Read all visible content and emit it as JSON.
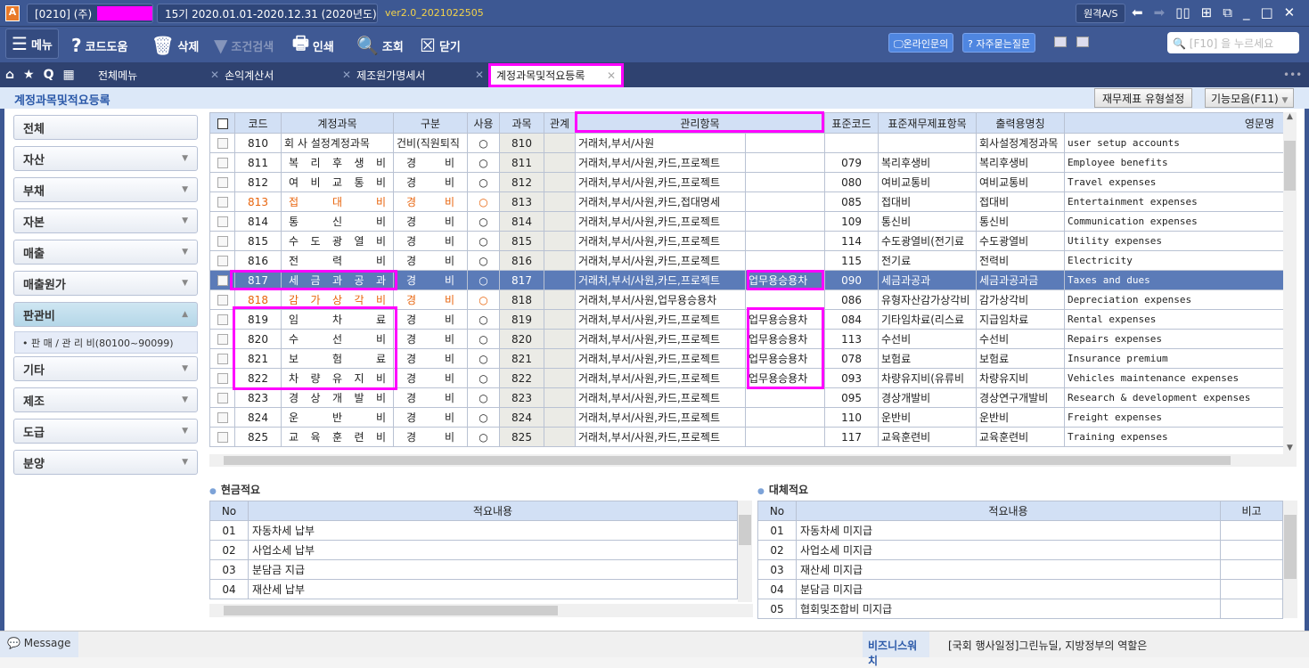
{
  "titlebar": {
    "company": "[0210] (주)",
    "period": "15기  2020.01.01-2020.12.31  (2020년도)",
    "version": "ver2.0_2021022505",
    "remote_as": "원격A/S"
  },
  "toolbar": {
    "menu": "메뉴",
    "code_help": "코드도움",
    "delete": "삭제",
    "filter": "조건검색",
    "print": "인쇄",
    "search": "조회",
    "close": "닫기",
    "online_inquiry": "온라인문의",
    "faq": "자주묻는질문",
    "search_placeholder": "[F10] 을 누르세요"
  },
  "tabs": [
    {
      "label": "전체메뉴"
    },
    {
      "label": "손익계산서"
    },
    {
      "label": "제조원가명세서"
    },
    {
      "label": "계정과목및적요등록"
    }
  ],
  "page": {
    "title": "계정과목및적요등록",
    "fs_type_btn": "재무제표 유형설정",
    "func_btn": "기능모음(F11)"
  },
  "sidebar": {
    "items": [
      {
        "label": "전체"
      },
      {
        "label": "자산"
      },
      {
        "label": "부채"
      },
      {
        "label": "자본"
      },
      {
        "label": "매출"
      },
      {
        "label": "매출원가"
      },
      {
        "label": "판관비"
      },
      {
        "label": "기타"
      },
      {
        "label": "제조"
      },
      {
        "label": "도급"
      },
      {
        "label": "분양"
      }
    ],
    "sub_item": "• 판 매 / 관 리 비(80100~90099)"
  },
  "grid": {
    "headers": [
      "코드",
      "계정과목",
      "구분",
      "사용",
      "과목",
      "관계",
      "관리항목",
      "표준코드",
      "표준재무제표항목",
      "출력용명칭",
      "영문명"
    ],
    "rows": [
      {
        "code": "810",
        "name": "회 사 설정계정과목",
        "type": "건비(직원퇴직",
        "use": "○",
        "subj": "810",
        "mgmt": "거래처,부서/사원",
        "mgmt2": "",
        "std": "",
        "stdname": "",
        "print": "회사설정계정과목",
        "eng": "user setup accounts"
      },
      {
        "code": "811",
        "name": "복 리 후 생 비",
        "type": "경 비",
        "use": "○",
        "subj": "811",
        "mgmt": "거래처,부서/사원,카드,프로젝트",
        "mgmt2": "",
        "std": "079",
        "stdname": "복리후생비",
        "print": "복리후생비",
        "eng": "Employee benefits"
      },
      {
        "code": "812",
        "name": "여 비 교 통 비",
        "type": "경 비",
        "use": "○",
        "subj": "812",
        "mgmt": "거래처,부서/사원,카드,프로젝트",
        "mgmt2": "",
        "std": "080",
        "stdname": "여비교통비",
        "print": "여비교통비",
        "eng": "Travel expenses"
      },
      {
        "code": "813",
        "name": "접 대 비",
        "type": "경 비",
        "use": "○",
        "subj": "813",
        "mgmt": "거래처,부서/사원,카드,접대명세",
        "mgmt2": "",
        "std": "085",
        "stdname": "접대비",
        "print": "접대비",
        "eng": "Entertainment expenses",
        "orange": true
      },
      {
        "code": "814",
        "name": "통 신 비",
        "type": "경 비",
        "use": "○",
        "subj": "814",
        "mgmt": "거래처,부서/사원,카드,프로젝트",
        "mgmt2": "",
        "std": "109",
        "stdname": "통신비",
        "print": "통신비",
        "eng": "Communication expenses"
      },
      {
        "code": "815",
        "name": "수 도 광 열 비",
        "type": "경 비",
        "use": "○",
        "subj": "815",
        "mgmt": "거래처,부서/사원,카드,프로젝트",
        "mgmt2": "",
        "std": "114",
        "stdname": "수도광열비(전기료",
        "print": "수도광열비",
        "eng": "Utility expenses"
      },
      {
        "code": "816",
        "name": "전 력 비",
        "type": "경 비",
        "use": "○",
        "subj": "816",
        "mgmt": "거래처,부서/사원,카드,프로젝트",
        "mgmt2": "",
        "std": "115",
        "stdname": "전기료",
        "print": "전력비",
        "eng": "Electricity"
      },
      {
        "code": "817",
        "name": "세 금 과 공 과",
        "type": "경 비",
        "use": "○",
        "subj": "817",
        "mgmt": "거래처,부서/사원,카드,프로젝트",
        "mgmt2": "업무용승용차",
        "std": "090",
        "stdname": "세금과공과",
        "print": "세금과공과금",
        "eng": "Taxes and dues",
        "selected": true
      },
      {
        "code": "818",
        "name": "감 가 상 각 비",
        "type": "경 비",
        "use": "○",
        "subj": "818",
        "mgmt": "거래처,부서/사원,업무용승용차",
        "mgmt2": "",
        "std": "086",
        "stdname": "유형자산감가상각비",
        "print": "감가상각비",
        "eng": "Depreciation expenses",
        "orange": true
      },
      {
        "code": "819",
        "name": "임 차 료",
        "type": "경 비",
        "use": "○",
        "subj": "819",
        "mgmt": "거래처,부서/사원,카드,프로젝트",
        "mgmt2": "업무용승용차",
        "std": "084",
        "stdname": "기타임차료(리스료",
        "print": "지급임차료",
        "eng": "Rental expenses"
      },
      {
        "code": "820",
        "name": "수 선 비",
        "type": "경 비",
        "use": "○",
        "subj": "820",
        "mgmt": "거래처,부서/사원,카드,프로젝트",
        "mgmt2": "업무용승용차",
        "std": "113",
        "stdname": "수선비",
        "print": "수선비",
        "eng": "Repairs expenses"
      },
      {
        "code": "821",
        "name": "보 험 료",
        "type": "경 비",
        "use": "○",
        "subj": "821",
        "mgmt": "거래처,부서/사원,카드,프로젝트",
        "mgmt2": "업무용승용차",
        "std": "078",
        "stdname": "보험료",
        "print": "보험료",
        "eng": "Insurance premium"
      },
      {
        "code": "822",
        "name": "차 량 유 지 비",
        "type": "경 비",
        "use": "○",
        "subj": "822",
        "mgmt": "거래처,부서/사원,카드,프로젝트",
        "mgmt2": "업무용승용차",
        "std": "093",
        "stdname": "차량유지비(유류비",
        "print": "차량유지비",
        "eng": "Vehicles maintenance expenses"
      },
      {
        "code": "823",
        "name": "경 상 개 발 비",
        "type": "경 비",
        "use": "○",
        "subj": "823",
        "mgmt": "거래처,부서/사원,카드,프로젝트",
        "mgmt2": "",
        "std": "095",
        "stdname": "경상개발비",
        "print": "경상연구개발비",
        "eng": "Research & development expenses"
      },
      {
        "code": "824",
        "name": "운 반 비",
        "type": "경 비",
        "use": "○",
        "subj": "824",
        "mgmt": "거래처,부서/사원,카드,프로젝트",
        "mgmt2": "",
        "std": "110",
        "stdname": "운반비",
        "print": "운반비",
        "eng": "Freight expenses"
      },
      {
        "code": "825",
        "name": "교 육 훈 련 비",
        "type": "경 비",
        "use": "○",
        "subj": "825",
        "mgmt": "거래처,부서/사원,카드,프로젝트",
        "mgmt2": "",
        "std": "117",
        "stdname": "교육훈련비",
        "print": "교육훈련비",
        "eng": "Training expenses"
      }
    ]
  },
  "cash": {
    "title": "현금적요",
    "headers": [
      "No",
      "적요내용"
    ],
    "rows": [
      {
        "no": "01",
        "text": "자동차세 납부"
      },
      {
        "no": "02",
        "text": "사업소세 납부"
      },
      {
        "no": "03",
        "text": "분담금 지급"
      },
      {
        "no": "04",
        "text": "재산세 납부"
      }
    ]
  },
  "transfer": {
    "title": "대체적요",
    "headers": [
      "No",
      "적요내용",
      "비고"
    ],
    "rows": [
      {
        "no": "01",
        "text": "자동차세 미지급"
      },
      {
        "no": "02",
        "text": "사업소세 미지급"
      },
      {
        "no": "03",
        "text": "재산세 미지급"
      },
      {
        "no": "04",
        "text": "분담금 미지급"
      },
      {
        "no": "05",
        "text": "협회및조합비 미지급"
      }
    ]
  },
  "status": {
    "message": "Message",
    "biz_label": "비즈니스워치",
    "news": "[국회 행사일정]그린뉴딜, 지방정부의 역할은"
  },
  "colors": {
    "selected": "#5b7bb8",
    "orange": "#e8640c",
    "highlight": "#ff00ff"
  }
}
